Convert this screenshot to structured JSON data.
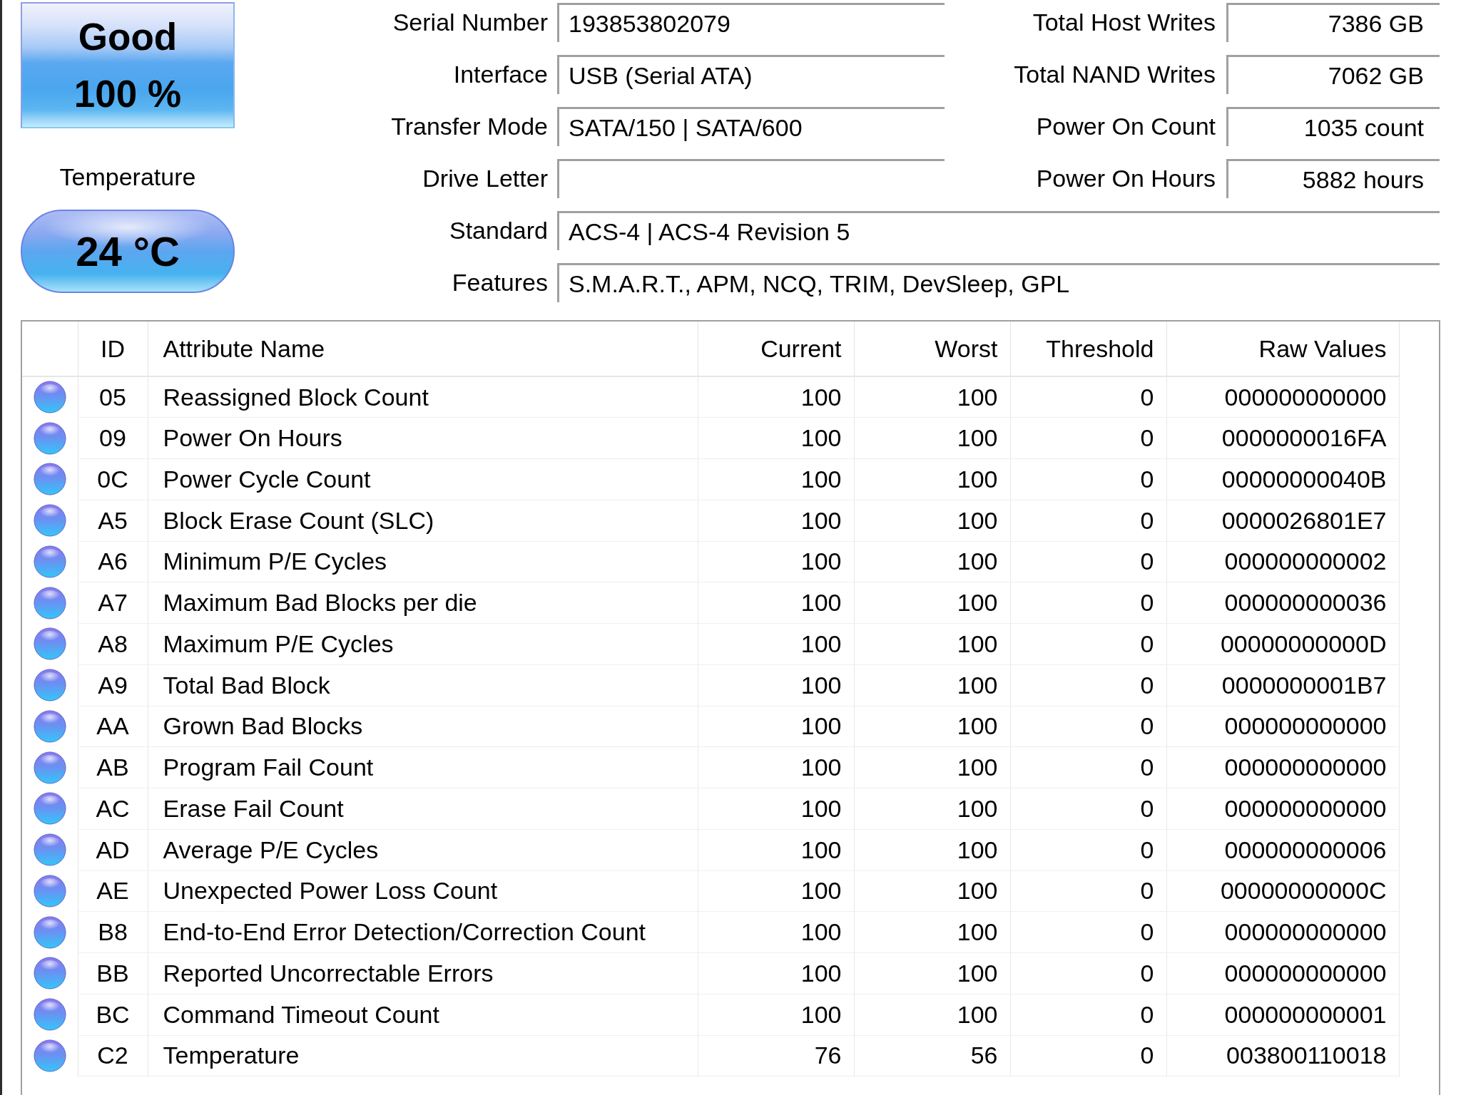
{
  "health": {
    "status": "Good",
    "percent": "100 %"
  },
  "temperature": {
    "label": "Temperature",
    "value": "24 °C"
  },
  "info_left": [
    {
      "label": "Serial Number",
      "value": "193853802079"
    },
    {
      "label": "Interface",
      "value": "USB (Serial ATA)"
    },
    {
      "label": "Transfer Mode",
      "value": "SATA/150 | SATA/600"
    },
    {
      "label": "Drive Letter"
    }
  ],
  "info_right": [
    {
      "label": "Total Host Writes",
      "value": "7386 GB"
    },
    {
      "label": "Total NAND Writes",
      "value": "7062 GB"
    },
    {
      "label": "Power On Count",
      "value": "1035 count"
    },
    {
      "label": "Power On Hours",
      "value": "5882 hours"
    }
  ],
  "info_wide": [
    {
      "label": "Standard",
      "value": "ACS-4 | ACS-4 Revision 5"
    },
    {
      "label": "Features",
      "value": "S.M.A.R.T., APM, NCQ, TRIM, DevSleep, GPL"
    }
  ],
  "smart_table": {
    "columns": [
      "ID",
      "Attribute Name",
      "Current",
      "Worst",
      "Threshold",
      "Raw Values"
    ],
    "rows": [
      [
        "05",
        "Reassigned Block Count",
        "100",
        "100",
        "0",
        "000000000000"
      ],
      [
        "09",
        "Power On Hours",
        "100",
        "100",
        "0",
        "0000000016FA"
      ],
      [
        "0C",
        "Power Cycle Count",
        "100",
        "100",
        "0",
        "00000000040B"
      ],
      [
        "A5",
        "Block Erase Count (SLC)",
        "100",
        "100",
        "0",
        "0000026801E7"
      ],
      [
        "A6",
        "Minimum P/E Cycles",
        "100",
        "100",
        "0",
        "000000000002"
      ],
      [
        "A7",
        "Maximum Bad Blocks per die",
        "100",
        "100",
        "0",
        "000000000036"
      ],
      [
        "A8",
        "Maximum P/E Cycles",
        "100",
        "100",
        "0",
        "00000000000D"
      ],
      [
        "A9",
        "Total Bad Block",
        "100",
        "100",
        "0",
        "0000000001B7"
      ],
      [
        "AA",
        "Grown Bad Blocks",
        "100",
        "100",
        "0",
        "000000000000"
      ],
      [
        "AB",
        "Program Fail Count",
        "100",
        "100",
        "0",
        "000000000000"
      ],
      [
        "AC",
        "Erase Fail Count",
        "100",
        "100",
        "0",
        "000000000000"
      ],
      [
        "AD",
        "Average P/E Cycles",
        "100",
        "100",
        "0",
        "000000000006"
      ],
      [
        "AE",
        "Unexpected Power Loss Count",
        "100",
        "100",
        "0",
        "00000000000C"
      ],
      [
        "B8",
        "End-to-End Error Detection/Correction Count",
        "100",
        "100",
        "0",
        "000000000000"
      ],
      [
        "BB",
        "Reported Uncorrectable Errors",
        "100",
        "100",
        "0",
        "000000000000"
      ],
      [
        "BC",
        "Command Timeout Count",
        "100",
        "100",
        "0",
        "000000000001"
      ],
      [
        "C2",
        "Temperature",
        "76",
        "56",
        "0",
        "003800110018"
      ]
    ]
  }
}
